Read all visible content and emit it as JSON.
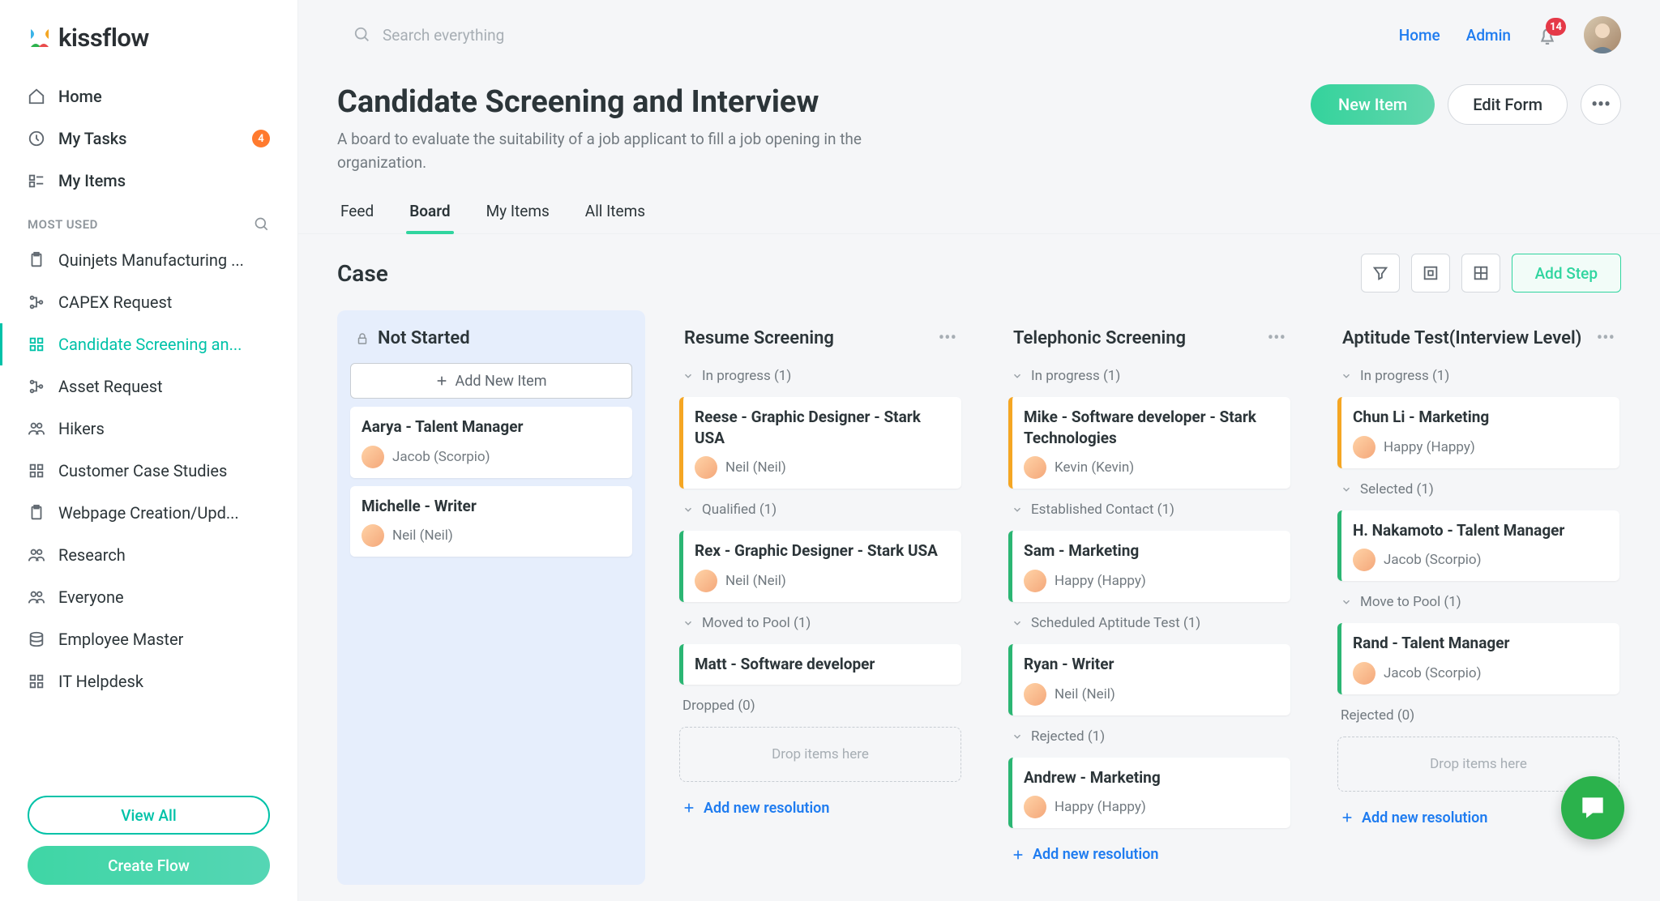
{
  "brand": "kissflow",
  "search": {
    "placeholder": "Search everything"
  },
  "topnav": {
    "home": "Home",
    "admin": "Admin",
    "notifications": "14"
  },
  "sidebar": {
    "items": [
      {
        "label": "Home"
      },
      {
        "label": "My Tasks",
        "badge": "4"
      },
      {
        "label": "My Items"
      }
    ],
    "section_title": "MOST USED",
    "most_used": [
      {
        "label": "Quinjets Manufacturing ..."
      },
      {
        "label": "CAPEX Request"
      },
      {
        "label": "Candidate Screening an..."
      },
      {
        "label": "Asset Request"
      },
      {
        "label": "Hikers"
      },
      {
        "label": "Customer Case Studies"
      },
      {
        "label": "Webpage Creation/Upd..."
      },
      {
        "label": "Research"
      },
      {
        "label": "Everyone"
      },
      {
        "label": "Employee Master"
      },
      {
        "label": "IT Helpdesk"
      }
    ],
    "view_all": "View All",
    "create_flow": "Create Flow"
  },
  "page": {
    "title": "Candidate Screening and Interview",
    "description": "A board to evaluate the suitability of a job applicant to fill a job opening in the organization.",
    "new_item": "New Item",
    "edit_form": "Edit Form"
  },
  "tabs": [
    "Feed",
    "Board",
    "My Items",
    "All Items"
  ],
  "board_title": "Case",
  "add_step": "Add Step",
  "add_new_item": "Add New Item",
  "drop_hint": "Drop items here",
  "add_resolution": "Add new resolution",
  "columns": [
    {
      "title": "Not Started",
      "locked": true,
      "first": true,
      "groups": [
        {
          "cards": [
            {
              "title": "Aarya - Talent Manager",
              "assignee": "Jacob (Scorpio)",
              "color": "none"
            },
            {
              "title": "Michelle - Writer",
              "assignee": "Neil (Neil)",
              "color": "none"
            }
          ]
        }
      ]
    },
    {
      "title": "Resume Screening",
      "groups": [
        {
          "label": "In progress  (1)",
          "cards": [
            {
              "title": "Reese - Graphic Designer - Stark USA",
              "assignee": "Neil (Neil)",
              "color": "orange"
            }
          ]
        },
        {
          "label": "Qualified  (1)",
          "cards": [
            {
              "title": "Rex - Graphic Designer - Stark USA",
              "assignee": "Neil (Neil)",
              "color": "green"
            }
          ]
        },
        {
          "label": "Moved to Pool  (1)",
          "cards": [
            {
              "title": "Matt - Software developer",
              "assignee": "",
              "color": "green"
            }
          ]
        },
        {
          "label": "Dropped  (0)",
          "plain": true
        }
      ],
      "dropzone": true,
      "addres": true
    },
    {
      "title": "Telephonic Screening",
      "groups": [
        {
          "label": "In progress  (1)",
          "cards": [
            {
              "title": "Mike - Software developer - Stark Technologies",
              "assignee": "Kevin (Kevin)",
              "color": "orange"
            }
          ]
        },
        {
          "label": "Established Contact  (1)",
          "cards": [
            {
              "title": "Sam - Marketing",
              "assignee": "Happy (Happy)",
              "color": "green"
            }
          ]
        },
        {
          "label": "Scheduled Aptitude Test  (1)",
          "cards": [
            {
              "title": "Ryan - Writer",
              "assignee": "Neil (Neil)",
              "color": "green"
            }
          ]
        },
        {
          "label": "Rejected  (1)",
          "cards": [
            {
              "title": "Andrew - Marketing",
              "assignee": "Happy (Happy)",
              "color": "green"
            }
          ]
        }
      ],
      "addres": true
    },
    {
      "title": "Aptitude Test(Interview Level)",
      "groups": [
        {
          "label": "In progress  (1)",
          "cards": [
            {
              "title": "Chun Li - Marketing",
              "assignee": "Happy (Happy)",
              "color": "orange"
            }
          ]
        },
        {
          "label": "Selected  (1)",
          "cards": [
            {
              "title": "H. Nakamoto - Talent Manager",
              "assignee": "Jacob (Scorpio)",
              "color": "green"
            }
          ]
        },
        {
          "label": "Move to Pool  (1)",
          "cards": [
            {
              "title": "Rand - Talent Manager",
              "assignee": "Jacob (Scorpio)",
              "color": "green"
            }
          ]
        },
        {
          "label": "Rejected  (0)",
          "plain": true
        }
      ],
      "dropzone": true,
      "addres": true
    }
  ]
}
